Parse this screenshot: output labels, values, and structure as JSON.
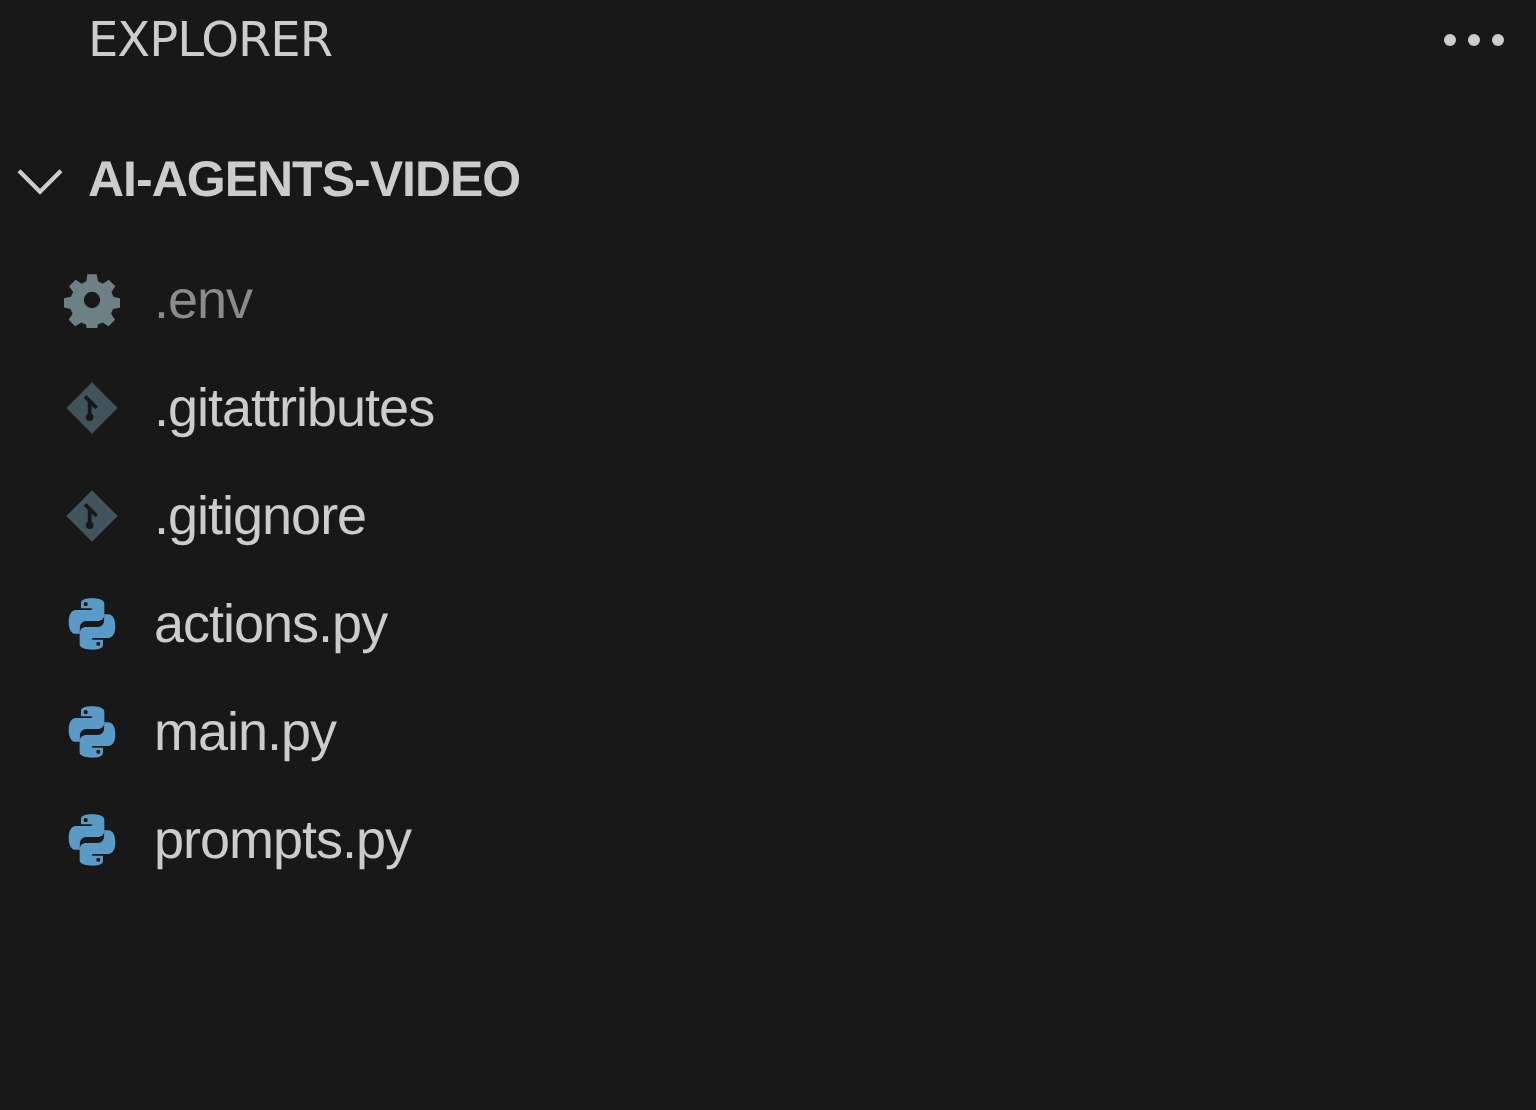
{
  "panel": {
    "title": "EXPLORER"
  },
  "folder": {
    "name": "AI-AGENTS-VIDEO",
    "expanded": true,
    "children": [
      {
        "name": ".env",
        "kind": "settings",
        "ignored": true
      },
      {
        "name": ".gitattributes",
        "kind": "git",
        "ignored": false
      },
      {
        "name": ".gitignore",
        "kind": "git",
        "ignored": false
      },
      {
        "name": "actions.py",
        "kind": "python",
        "ignored": false
      },
      {
        "name": "main.py",
        "kind": "python",
        "ignored": false
      },
      {
        "name": "prompts.py",
        "kind": "python",
        "ignored": false
      }
    ]
  }
}
